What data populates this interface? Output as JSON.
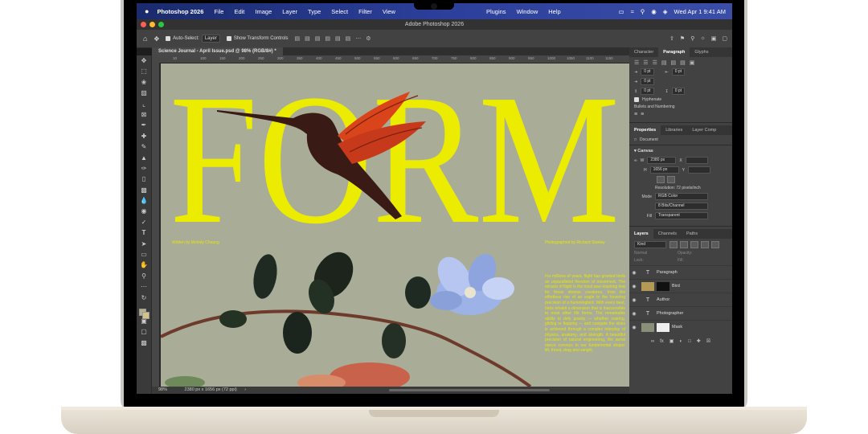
{
  "menubar": {
    "apple": "",
    "app": "Photoshop 2026",
    "items": [
      "File",
      "Edit",
      "Image",
      "Layer",
      "Type",
      "Select",
      "Filter",
      "View"
    ],
    "right_items": [
      "Plugins",
      "Window",
      "Help"
    ],
    "clock": "Wed Apr 1  9:41 AM"
  },
  "window": {
    "title": "Adobe Photoshop 2026"
  },
  "options": {
    "auto_select_label": "Auto-Select:",
    "auto_select_value": "Layer",
    "transform_label": "Show Transform Controls"
  },
  "document": {
    "tab": "Science Journal - April Issue.psd @ 98% (RGB/8#) *",
    "ruler_ticks": [
      "10",
      "100",
      "150",
      "200",
      "250",
      "300",
      "350",
      "400",
      "450",
      "500",
      "550",
      "600",
      "650",
      "700",
      "750",
      "800",
      "850",
      "900",
      "950",
      "1000",
      "1050",
      "1100",
      "1150"
    ]
  },
  "artwork": {
    "headline": "FORM",
    "left_credit": "Written by Melody Chaung",
    "right_credit": "Photographed by Richard Stanley",
    "body": "For millions of years, flight has granted birds an unparalleled freedom of movement. The miracle of flight is the most awe-inspiring feat for these diverse creatures, from the effortless rise of an eagle to the hovering precision of a hummingbird. With every beat, birds inhabit a dimension that is inaccessible to most other life forms. The remarkable ability to defy gravity — whether soaring, gliding or flapping — and navigate the skies is achieved through a complex interplay of physics, anatomy, and strength. A beautiful precision of natural engineering, the aerial dance conveys to our fundamental shape: lift, thrust, drag and weight."
  },
  "status": {
    "zoom": "98%",
    "size": "2380 px x 1656 px (72 ppi)"
  },
  "paragraph_panel": {
    "tabs": [
      "Character",
      "Paragraph",
      "Glyphs"
    ],
    "active": "Paragraph",
    "indent_values": [
      "0 pt",
      "0 pt",
      "0 pt",
      "0 pt",
      "0 pt"
    ],
    "hyphenate": "Hyphenate",
    "bullets": "Bullets and Numbering"
  },
  "properties_panel": {
    "tabs": [
      "Properties",
      "Libraries",
      "Layer Comp"
    ],
    "doc_label": "Document",
    "canvas_label": "Canvas",
    "w_label": "W",
    "w_value": "2380 px",
    "h_label": "H",
    "h_value": "1656 px",
    "x_label": "X",
    "y_label": "Y",
    "resolution": "Resolution: 72 pixels/inch",
    "mode_label": "Mode",
    "mode_value": "RGB Color",
    "depth_value": "8 Bits/Channel",
    "fill_label": "Fill",
    "fill_value": "Transparent"
  },
  "layers_panel": {
    "tabs": [
      "Layers",
      "Channels",
      "Paths"
    ],
    "filter": "Kind",
    "blend": "Normal",
    "opacity_label": "Opacity:",
    "lock_label": "Lock:",
    "fill_label": "Fill:",
    "layers": [
      {
        "name": "Paragraph",
        "kind": "T"
      },
      {
        "name": "Bird",
        "kind": "img"
      },
      {
        "name": "Author",
        "kind": "T"
      },
      {
        "name": "Photographer",
        "kind": "T"
      },
      {
        "name": "Mask",
        "kind": "img"
      }
    ]
  },
  "colors": {
    "accent_yellow": "#ecec00",
    "artboard": "#a9ad98"
  }
}
